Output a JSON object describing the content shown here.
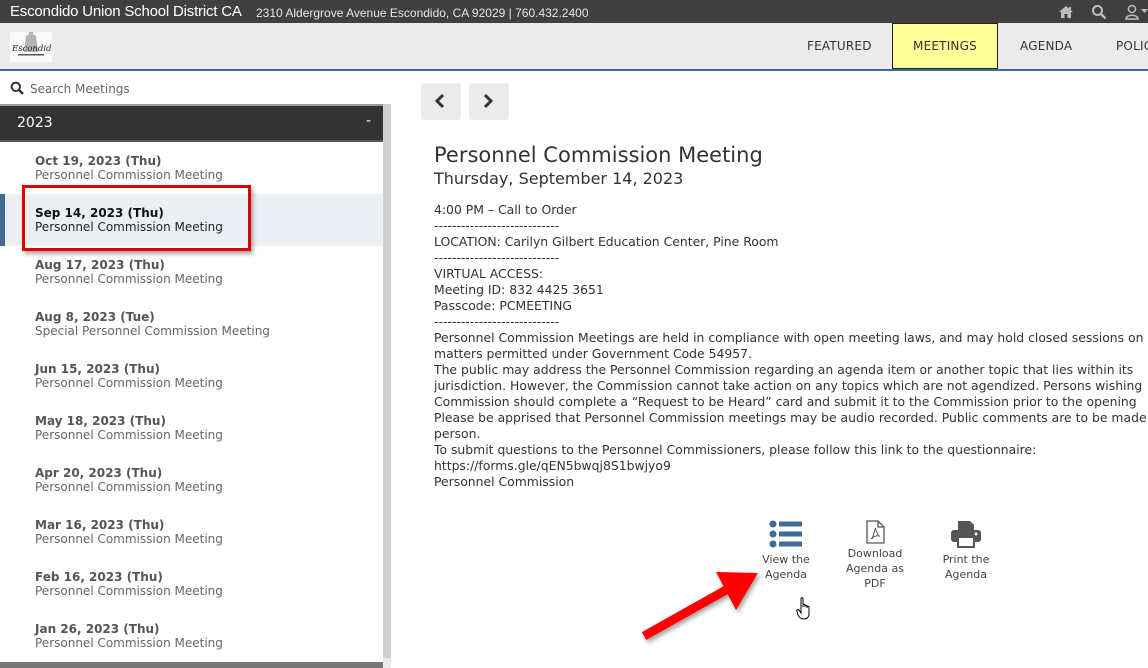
{
  "topbar": {
    "district_name": "Escondido Union School District CA",
    "address": "2310 Aldergrove Avenue Escondido, CA 92029 | 760.432.2400",
    "icons": [
      "home-icon",
      "search-icon",
      "user-icon"
    ]
  },
  "nav": {
    "logo_alt": "Escondido",
    "links": [
      {
        "label": "FEATURED",
        "active": false
      },
      {
        "label": "MEETINGS",
        "active": true
      },
      {
        "label": "AGENDA",
        "active": false
      },
      {
        "label": "POLICIES",
        "active": false
      }
    ]
  },
  "sidebar": {
    "search_placeholder": "Search Meetings",
    "year": "2023",
    "collapse_symbol": "-",
    "meetings": [
      {
        "date": "Oct 19, 2023 (Thu)",
        "title": "Personnel Commission Meeting",
        "selected": false
      },
      {
        "date": "Sep 14, 2023 (Thu)",
        "title": "Personnel Commission Meeting",
        "selected": true
      },
      {
        "date": "Aug 17, 2023 (Thu)",
        "title": "Personnel Commission Meeting",
        "selected": false
      },
      {
        "date": "Aug 8, 2023 (Tue)",
        "title": "Special Personnel Commission Meeting",
        "selected": false
      },
      {
        "date": "Jun 15, 2023 (Thu)",
        "title": "Personnel Commission Meeting",
        "selected": false
      },
      {
        "date": "May 18, 2023 (Thu)",
        "title": "Personnel Commission Meeting",
        "selected": false
      },
      {
        "date": "Apr 20, 2023 (Thu)",
        "title": "Personnel Commission Meeting",
        "selected": false
      },
      {
        "date": "Mar 16, 2023 (Thu)",
        "title": "Personnel Commission Meeting",
        "selected": false
      },
      {
        "date": "Feb 16, 2023 (Thu)",
        "title": "Personnel Commission Meeting",
        "selected": false
      },
      {
        "date": "Jan 26, 2023 (Thu)",
        "title": "Personnel Commission Meeting",
        "selected": false
      }
    ]
  },
  "main": {
    "title": "Personnel Commission Meeting",
    "date": "Thursday, September 14, 2023",
    "description_lines": [
      "4:00 PM – Call to Order",
      "----------------------------",
      "LOCATION: Carilyn Gilbert Education Center, Pine Room",
      "----------------------------",
      "VIRTUAL ACCESS:",
      "Meeting ID: 832 4425 3651",
      "Passcode: PCMEETING",
      "----------------------------",
      "Personnel Commission Meetings are held in compliance with open meeting laws, and may hold closed sessions on",
      "matters permitted under Government Code 54957.",
      "The public may address the Personnel Commission regarding an agenda item or another topic that lies within its",
      "jurisdiction. However, the Commission cannot take action on any topics which are not agendized. Persons wishing",
      "Commission should complete a “Request to be Heard” card and submit it to the Commission prior to the opening",
      "Please be apprised that Personnel Commission meetings may be audio recorded. Public comments are to be made in",
      "person.",
      "To submit questions to the Personnel Commissioners, please follow this link to the questionnaire:",
      "https://forms.gle/qEN5bwqj8S1bwjyo9",
      "Personnel Commission"
    ],
    "actions": [
      {
        "label_lines": [
          "View the",
          "Agenda"
        ],
        "icon": "list-icon"
      },
      {
        "label_lines": [
          "Download",
          "Agenda as",
          "PDF"
        ],
        "icon": "pdf-icon"
      },
      {
        "label_lines": [
          "Print the",
          "Agenda"
        ],
        "icon": "printer-icon"
      }
    ]
  },
  "colors": {
    "accent": "#3f6b94",
    "active_tab": "#ffff99",
    "annotation_red": "#e00000",
    "topbar": "#404040"
  }
}
